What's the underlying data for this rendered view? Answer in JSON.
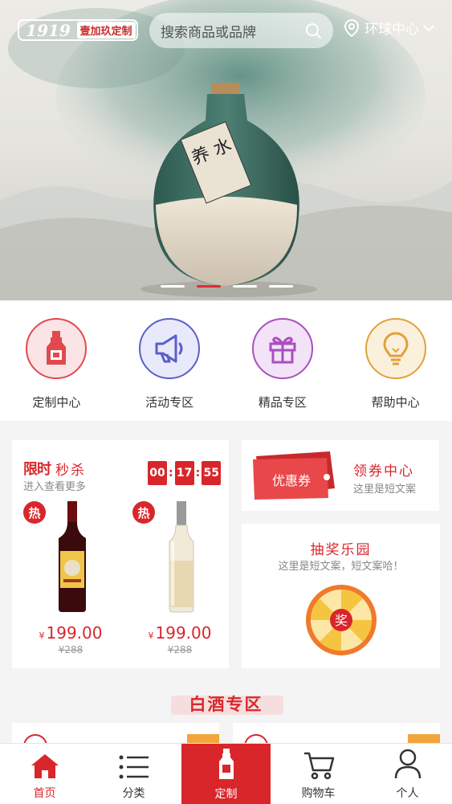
{
  "header": {
    "logo_text": "1919 壹加玖定制",
    "search_placeholder": "搜索商品或品牌",
    "location": "环球中心"
  },
  "banner": {
    "label_text": "养 水",
    "slides": 4,
    "active_slide": 2
  },
  "menu": [
    {
      "label": "定制中心",
      "icon": "bottle-icon",
      "color": "#e04a4f"
    },
    {
      "label": "活动专区",
      "icon": "megaphone-icon",
      "color": "#5b5fc7"
    },
    {
      "label": "精品专区",
      "icon": "gift-icon",
      "color": "#a94fbf"
    },
    {
      "label": "帮助中心",
      "icon": "lightbulb-icon",
      "color": "#e0a13c"
    }
  ],
  "seckill": {
    "logo": "限时",
    "title": "秒杀",
    "subtitle": "进入查看更多",
    "timer": {
      "h": "00",
      "m": "17",
      "s": "55"
    },
    "products": [
      {
        "badge": "热",
        "currency": "¥",
        "price": "199.00",
        "original": "¥288"
      },
      {
        "badge": "热",
        "currency": "¥",
        "price": "199.00",
        "original": "¥288"
      }
    ]
  },
  "coupon": {
    "ticket_label": "优惠券",
    "title": "领券中心",
    "subtitle": "这里是短文案"
  },
  "lottery": {
    "title": "抽奖乐园",
    "subtitle": "这里是短文案，短文案哈！",
    "wheel_label": "奖"
  },
  "section": {
    "title": "白酒专区"
  },
  "tabbar": [
    {
      "label": "首页",
      "icon": "home-icon"
    },
    {
      "label": "分类",
      "icon": "list-icon"
    },
    {
      "label": "定制",
      "icon": "bottle-icon"
    },
    {
      "label": "购物车",
      "icon": "cart-icon"
    },
    {
      "label": "个人",
      "icon": "user-icon"
    }
  ],
  "colors": {
    "brand_red": "#d9262b",
    "coupon_red": "#e8484a",
    "lottery_yellow": "#f5c542"
  }
}
